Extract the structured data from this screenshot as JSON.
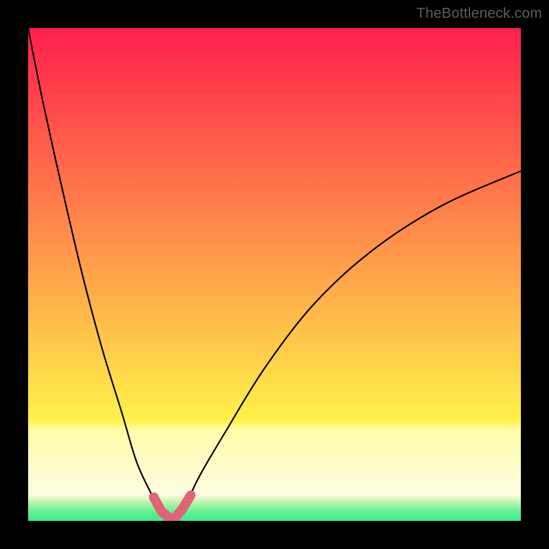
{
  "watermark": "TheBottleneck.com",
  "colors": {
    "frame_bg": "#000000",
    "text": "#5d5d5d",
    "curve": "#000000",
    "highlight": "#e06377",
    "gradient_stops": [
      {
        "t": 0.0,
        "c": "#ff1f4b"
      },
      {
        "t": 0.18,
        "c": "#ff4a3a"
      },
      {
        "t": 0.36,
        "c": "#ff7a2f"
      },
      {
        "t": 0.54,
        "c": "#ffb028"
      },
      {
        "t": 0.72,
        "c": "#ffe22d"
      },
      {
        "t": 0.797,
        "c": "#fff24a"
      },
      {
        "t": 0.81,
        "c": "#fffca8"
      },
      {
        "t": 0.9,
        "c": "#fffde0"
      },
      {
        "t": 0.97,
        "c": "#b7f7a0"
      },
      {
        "t": 1.0,
        "c": "#3cf08c"
      }
    ],
    "bands": [
      {
        "top": 0.0,
        "bottom": 0.797,
        "grad_from": "#ff1f4b",
        "grad_to": "#fff24a"
      },
      {
        "top": 0.797,
        "bottom": 0.815,
        "grad_from": "#fff24a",
        "grad_to": "#fffca8"
      },
      {
        "top": 0.815,
        "bottom": 0.947,
        "grad_from": "#fffca8",
        "grad_to": "#fdfce2"
      },
      {
        "top": 0.947,
        "bottom": 0.96,
        "grad_from": "#fdfce2",
        "grad_to": "#c8f6b2"
      },
      {
        "top": 0.96,
        "bottom": 0.972,
        "grad_from": "#c8f6b2",
        "grad_to": "#8ef29e"
      },
      {
        "top": 0.972,
        "bottom": 0.985,
        "grad_from": "#8ef29e",
        "grad_to": "#58ef93"
      },
      {
        "top": 0.985,
        "bottom": 1.0,
        "grad_from": "#58ef93",
        "grad_to": "#37ee8b"
      }
    ]
  },
  "chart_data": {
    "type": "line",
    "title": "",
    "xlabel": "",
    "ylabel": "",
    "xlim": [
      0,
      100
    ],
    "ylim": [
      0,
      100
    ],
    "series": [
      {
        "name": "bottleneck-curve",
        "x": [
          0,
          3,
          7,
          11,
          15,
          19,
          22,
          25,
          27,
          28.6,
          29.8,
          32,
          35,
          40,
          48,
          58,
          70,
          84,
          100
        ],
        "y": [
          100,
          85,
          67,
          50,
          35,
          22,
          12,
          5.5,
          2.0,
          0.6,
          0.6,
          3.5,
          9.5,
          18,
          31,
          44,
          55,
          64,
          71
        ]
      }
    ],
    "highlight_region": {
      "description": "near-zero bottleneck segment",
      "x": [
        25.5,
        27,
        28.6,
        29.8,
        31.3,
        33
      ],
      "y": [
        4.8,
        2.0,
        0.6,
        0.6,
        2.4,
        5.2
      ]
    }
  }
}
